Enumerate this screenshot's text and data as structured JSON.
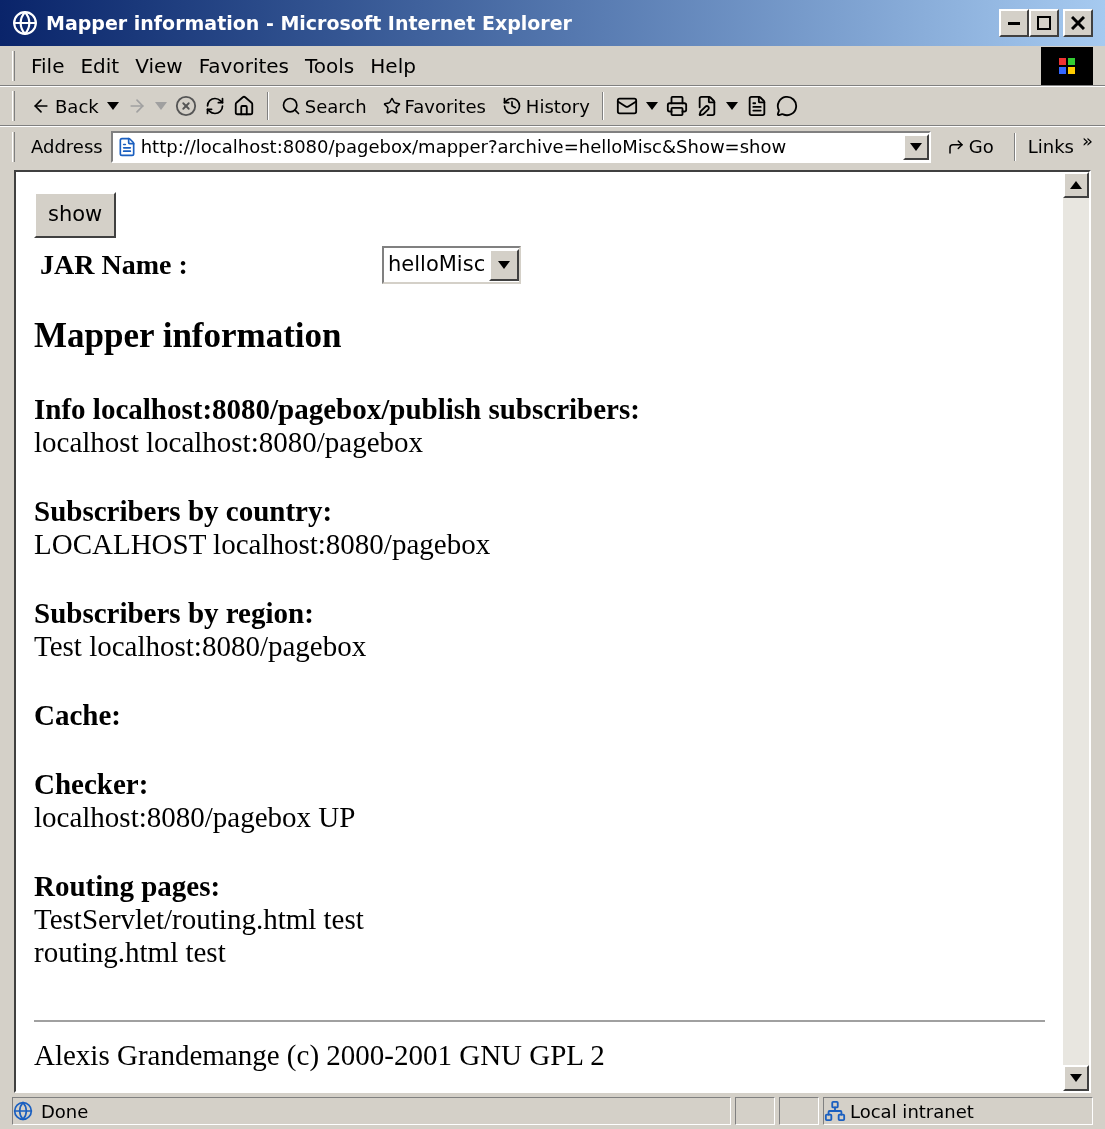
{
  "window": {
    "title": "Mapper information - Microsoft Internet Explorer"
  },
  "menu": [
    "File",
    "Edit",
    "View",
    "Favorites",
    "Tools",
    "Help"
  ],
  "toolbar": {
    "back": "Back",
    "forward_disabled": true,
    "search": "Search",
    "favorites": "Favorites",
    "history": "History"
  },
  "address": {
    "label": "Address",
    "url": "http://localhost:8080/pagebox/mapper?archive=helloMisc&Show=show",
    "go": "Go",
    "links": "Links",
    "more": "»"
  },
  "form": {
    "button": "show",
    "jar_label": "JAR Name :",
    "jar_value": "helloMisc"
  },
  "heading": "Mapper information",
  "sections": [
    {
      "title": "Info localhost:8080/pagebox/publish subscribers:",
      "lines": [
        "localhost localhost:8080/pagebox"
      ]
    },
    {
      "title": "Subscribers by country:",
      "lines": [
        "LOCALHOST localhost:8080/pagebox"
      ]
    },
    {
      "title": "Subscribers by region:",
      "lines": [
        "Test localhost:8080/pagebox"
      ]
    },
    {
      "title": "Cache:"
    },
    {
      "title": "Checker:",
      "lines": [
        "localhost:8080/pagebox UP"
      ]
    },
    {
      "title": "Routing pages:",
      "lines": [
        "TestServlet/routing.html test",
        "routing.html test"
      ]
    }
  ],
  "footer": "Alexis Grandemange (c) 2000-2001 GNU GPL 2",
  "status": {
    "text": "Done",
    "zone": "Local intranet"
  }
}
